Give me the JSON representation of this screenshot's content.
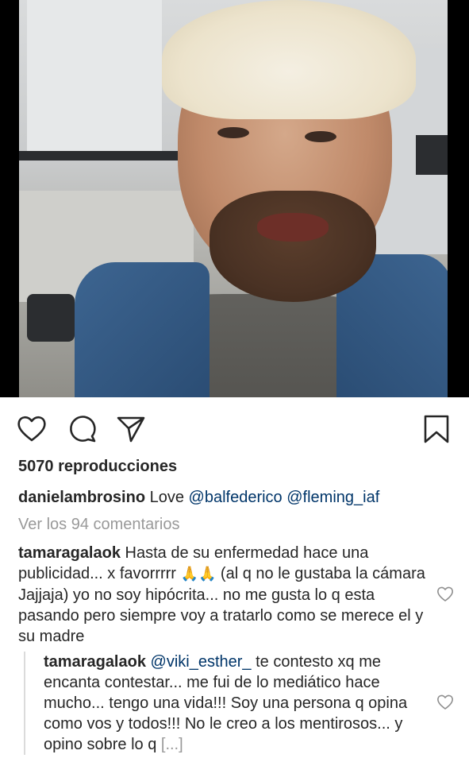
{
  "post": {
    "views_count": "5070",
    "views_label": "reproducciones",
    "caption": {
      "username": "danielambrosino",
      "text": "Love",
      "mention_1": "@balfederico",
      "mention_2": "@fleming_iaf"
    },
    "view_comments_label": "Ver los 94 comentarios"
  },
  "actions": {
    "like_icon": "heart-outline-icon",
    "comment_icon": "speech-bubble-icon",
    "share_icon": "paper-plane-icon",
    "save_icon": "bookmark-icon"
  },
  "comments": [
    {
      "username": "tamaragalaok",
      "text_1": "Hasta de su enfermedad hace una publicidad... x favorrrrr",
      "emoji": "🙏🙏",
      "text_2": "(al q no le gustaba la cámara Jajjaja) yo no soy hipócrita... no me gusta lo q esta pasando pero siempre voy a tratarlo como se merece el y su madre"
    }
  ],
  "reply": {
    "username": "tamaragalaok",
    "mention": "@viki_esther_",
    "text": "te contesto xq me encanta contestar... me fui de lo mediático hace mucho... tengo una vida!!! Soy una persona q opina como vos y todos!!! No le creo a los mentirosos... y opino sobre lo q",
    "more_label": "[...]"
  },
  "colors": {
    "text": "#262626",
    "muted": "#999999",
    "mention": "#003569",
    "background": "#ffffff"
  }
}
